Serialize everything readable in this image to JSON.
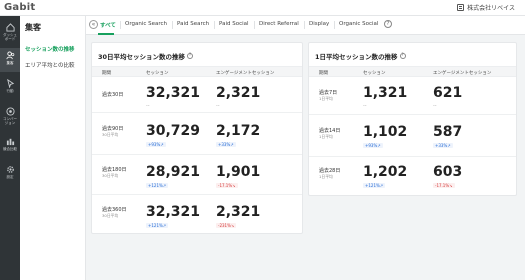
{
  "app": {
    "logo": "Gabit",
    "company": "株式会社リベイス"
  },
  "rail": [
    {
      "label": "ダッシュ\nボード",
      "icon": "home-icon"
    },
    {
      "label": "集客",
      "icon": "users-icon"
    },
    {
      "label": "行動",
      "icon": "cursor-icon"
    },
    {
      "label": "コンバー\nジョン",
      "icon": "target-icon"
    },
    {
      "label": "競合比較",
      "icon": "compare-icon"
    },
    {
      "label": "設定",
      "icon": "gear-icon"
    }
  ],
  "subnav": {
    "title": "集客",
    "items": [
      "セッション数の推移",
      "エリア平均との比較"
    ]
  },
  "tabs": [
    "すべて",
    "Organic Search",
    "Paid Search",
    "Paid Social",
    "Direct Referral",
    "Display",
    "Organic Social"
  ],
  "left_card": {
    "title": "30日平均セッション数の推移",
    "headers": [
      "期間",
      "セッション",
      "エンゲージメントセッション"
    ],
    "rows": [
      {
        "label": "過去30日",
        "sub": "",
        "session": "32,321",
        "session_badge": "",
        "engaged": "2,321",
        "engaged_badge": "",
        "session_dash": "--",
        "engaged_dash": "--"
      },
      {
        "label": "過去90日",
        "sub": "30日平均",
        "session": "30,729",
        "session_badge": "+93%↗",
        "engaged": "2,172",
        "engaged_badge": "+33%↗"
      },
      {
        "label": "過去180日",
        "sub": "30日平均",
        "session": "28,921",
        "session_badge": "+121%↗",
        "engaged": "1,901",
        "engaged_badge": "-17.1%↘"
      },
      {
        "label": "過去360日",
        "sub": "30日平均",
        "session": "32,321",
        "session_badge": "+121%↗",
        "engaged": "2,321",
        "engaged_badge": "-231%↘"
      }
    ]
  },
  "right_card": {
    "title": "1日平均セッション数の推移",
    "headers": [
      "期間",
      "セッション",
      "エンゲージメントセッション"
    ],
    "rows": [
      {
        "label": "過去7日",
        "sub": "1日平均",
        "session": "1,321",
        "session_dash": "--",
        "engaged": "621",
        "engaged_dash": "--"
      },
      {
        "label": "過去14日",
        "sub": "1日平均",
        "session": "1,102",
        "session_badge": "+93%↗",
        "engaged": "587",
        "engaged_badge": "+33%↗"
      },
      {
        "label": "過去28日",
        "sub": "1日平均",
        "session": "1,202",
        "session_badge": "+121%↗",
        "engaged": "603",
        "engaged_badge": "-17.1%↘"
      }
    ]
  },
  "colors": {
    "accent": "#17a05d",
    "rail": "#2f3437",
    "up": "#2a6fd6",
    "down": "#d63a3a"
  }
}
